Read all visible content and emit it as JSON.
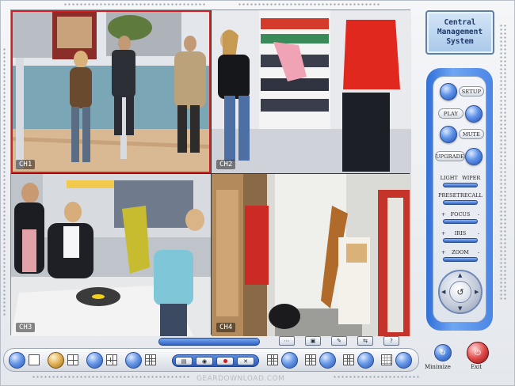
{
  "app": {
    "brand_title": "Central\nManagement\nSystem",
    "watermark": "GEARDOWNLOAD.COM"
  },
  "cameras": [
    {
      "id": "cam1",
      "scene": "mall-entrance",
      "selected": true
    },
    {
      "id": "cam2",
      "scene": "clothing-rack",
      "selected": false
    },
    {
      "id": "cam3",
      "scene": "checkout-counter",
      "selected": false
    },
    {
      "id": "cam4",
      "scene": "stock-room",
      "selected": false
    }
  ],
  "ptz": {
    "setup": "SETUP",
    "play": "PLAY",
    "mute": "MUTE",
    "upgrade": "UPGRADE",
    "light": "LIGHT",
    "wiper": "WIPER",
    "preset": "PRESET",
    "recall": "RECALL",
    "focus": "FOCUS",
    "iris": "IRIS",
    "zoom": "ZOOM",
    "plus": "+",
    "minus": "-"
  },
  "system": {
    "minimize": "Minimize",
    "exit": "Exit"
  },
  "toolbar": {
    "icons": [
      "snapshot-icon",
      "camera-icon",
      "record-icon",
      "tools-icon"
    ],
    "strip_icons": [
      "grid-dots-icon",
      "monitor-icon",
      "pen-icon",
      "link-icon",
      "help-icon"
    ]
  },
  "colors": {
    "selected_border": "#d42020",
    "accent_blue": "#2f6fd8",
    "exit_red": "#e04a4a"
  }
}
